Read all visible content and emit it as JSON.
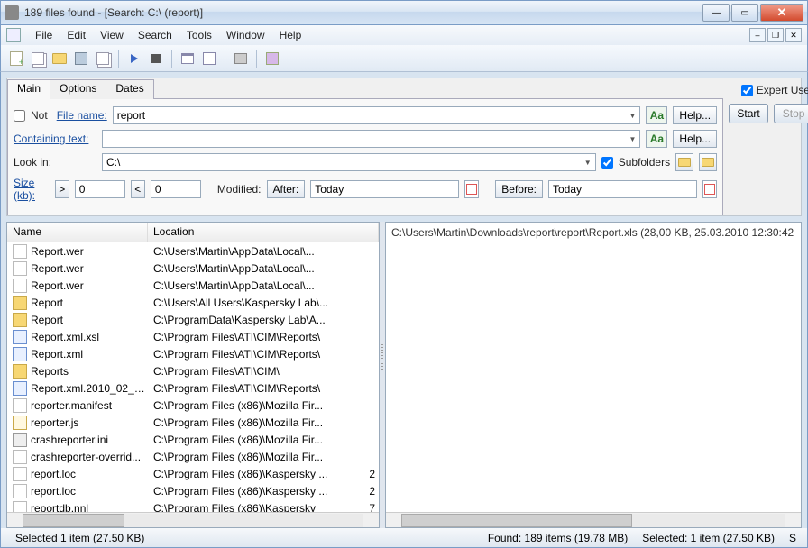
{
  "window": {
    "title": "189 files found - [Search: C:\\ (report)]"
  },
  "menu": {
    "items": [
      "File",
      "Edit",
      "View",
      "Search",
      "Tools",
      "Window",
      "Help"
    ]
  },
  "tabs": {
    "main": "Main",
    "options": "Options",
    "dates": "Dates"
  },
  "search": {
    "not_label": "Not",
    "filename_label": "File name:",
    "filename_value": "report",
    "containing_label": "Containing text:",
    "containing_value": "",
    "lookin_label": "Look in:",
    "lookin_value": "C:\\",
    "subfolders_label": "Subfolders",
    "size_label": "Size (kb):",
    "size_from": "0",
    "size_to": "0",
    "modified_label": "Modified:",
    "after_label": "After:",
    "before_label": "Before:",
    "after_value": "Today",
    "before_value": "Today",
    "help_label": "Help...",
    "aa_label": "Aa"
  },
  "side": {
    "expert_label": "Expert User",
    "start_label": "Start",
    "stop_label": "Stop"
  },
  "columns": {
    "name": "Name",
    "location": "Location"
  },
  "files": [
    {
      "icon": "file",
      "name": "Report.wer",
      "loc": "C:\\Users\\Martin\\AppData\\Local\\...",
      "s": ""
    },
    {
      "icon": "file",
      "name": "Report.wer",
      "loc": "C:\\Users\\Martin\\AppData\\Local\\...",
      "s": ""
    },
    {
      "icon": "file",
      "name": "Report.wer",
      "loc": "C:\\Users\\Martin\\AppData\\Local\\...",
      "s": ""
    },
    {
      "icon": "folder",
      "name": "Report",
      "loc": "C:\\Users\\All Users\\Kaspersky Lab\\...",
      "s": ""
    },
    {
      "icon": "folder",
      "name": "Report",
      "loc": "C:\\ProgramData\\Kaspersky Lab\\A...",
      "s": ""
    },
    {
      "icon": "xml",
      "name": "Report.xml.xsl",
      "loc": "C:\\Program Files\\ATI\\CIM\\Reports\\",
      "s": ""
    },
    {
      "icon": "xml",
      "name": "Report.xml",
      "loc": "C:\\Program Files\\ATI\\CIM\\Reports\\",
      "s": ""
    },
    {
      "icon": "folder",
      "name": "Reports",
      "loc": "C:\\Program Files\\ATI\\CIM\\",
      "s": ""
    },
    {
      "icon": "xml",
      "name": "Report.xml.2010_02_2...",
      "loc": "C:\\Program Files\\ATI\\CIM\\Reports\\",
      "s": ""
    },
    {
      "icon": "file",
      "name": "reporter.manifest",
      "loc": "C:\\Program Files (x86)\\Mozilla Fir...",
      "s": ""
    },
    {
      "icon": "js",
      "name": "reporter.js",
      "loc": "C:\\Program Files (x86)\\Mozilla Fir...",
      "s": ""
    },
    {
      "icon": "ini",
      "name": "crashreporter.ini",
      "loc": "C:\\Program Files (x86)\\Mozilla Fir...",
      "s": ""
    },
    {
      "icon": "file",
      "name": "crashreporter-overrid...",
      "loc": "C:\\Program Files (x86)\\Mozilla Fir...",
      "s": ""
    },
    {
      "icon": "file",
      "name": "report.loc",
      "loc": "C:\\Program Files (x86)\\Kaspersky ...",
      "s": "2"
    },
    {
      "icon": "file",
      "name": "report.loc",
      "loc": "C:\\Program Files (x86)\\Kaspersky ...",
      "s": "2"
    },
    {
      "icon": "file",
      "name": "reportdb.nnl",
      "loc": "C:\\Program Files (x86)\\Kaspersky ",
      "s": "7"
    }
  ],
  "preview": {
    "path": "C:\\Users\\Martin\\Downloads\\report\\report\\Report.xls   (28,00 KB,  25.03.2010 12:30:42"
  },
  "status": {
    "left": "Selected 1 item (27.50 KB)",
    "found": "Found: 189 items (19.78 MB)",
    "selected": "Selected: 1 item (27.50 KB)",
    "mode": "S"
  }
}
